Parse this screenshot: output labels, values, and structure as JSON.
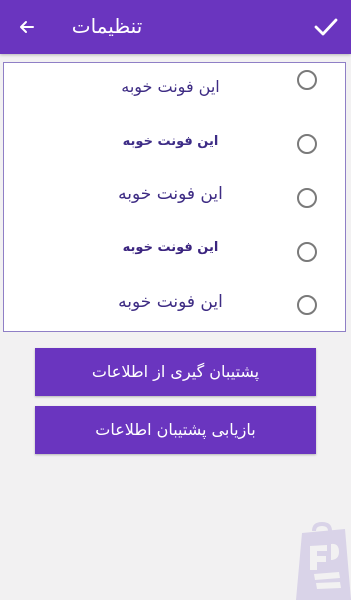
{
  "toolbar": {
    "title": "تنظیمات",
    "back_icon": "arrow-left-icon",
    "confirm_icon": "check-icon",
    "background": "#6a35bf"
  },
  "fonts": {
    "options": [
      {
        "label": "این فونت خوبه",
        "selected": false
      },
      {
        "label": "این فونت خوبه",
        "selected": false
      },
      {
        "label": "این فونت خوبه",
        "selected": false
      },
      {
        "label": "این فونت خوبه",
        "selected": false
      },
      {
        "label": "این فونت خوبه",
        "selected": false
      }
    ]
  },
  "actions": {
    "backup_label": "پشتیبان گیری از اطلاعات",
    "restore_label": "بازیابی پشتیبان اطلاعات"
  },
  "brand": {
    "logo_icon": "shopping-bag-logo-icon",
    "color": "#d9d3e8"
  },
  "colors": {
    "accent": "#6a35bf",
    "panel_border": "#8f7fc6",
    "background": "#f2f1f2"
  }
}
